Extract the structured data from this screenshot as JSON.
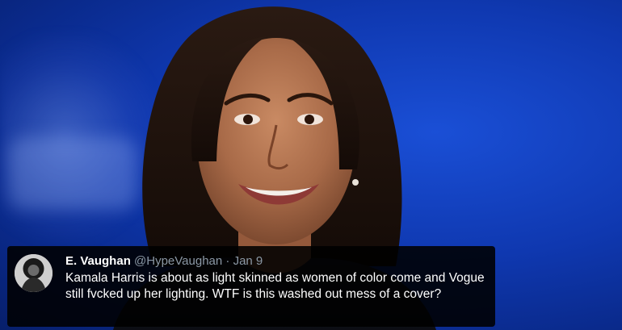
{
  "tweet": {
    "name": "E. Vaughan",
    "handle": "@HypeVaughan",
    "separator": "·",
    "date": "Jan 9",
    "text": "Kamala Harris is about as light skinned as women of color come and Vogue still fvcked up her lighting. WTF is this washed out mess of a cover?"
  },
  "colors": {
    "background": "#0f38b0",
    "tweet_card": "#000000",
    "handle_gray": "#8b98a5"
  }
}
